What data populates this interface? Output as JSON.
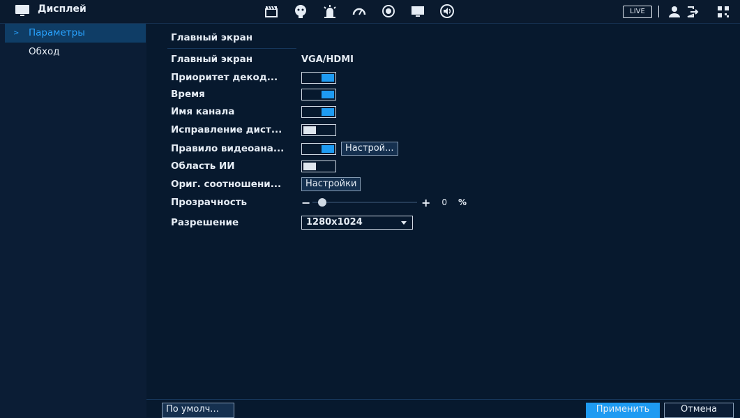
{
  "window": {
    "title": "Дисплей"
  },
  "topbar": {
    "icons": [
      "clapperboard-icon",
      "face-icon",
      "alarm-icon",
      "gauge-icon",
      "record-icon",
      "display-icon",
      "volume-icon"
    ],
    "live_label": "LIVE",
    "right_icons": [
      "user-icon",
      "logout-icon",
      "qr-icon"
    ]
  },
  "sidebar": {
    "items": [
      {
        "label": "Параметры",
        "active": true
      },
      {
        "label": "Обход",
        "active": false
      }
    ]
  },
  "main": {
    "section_title": "Главный экран",
    "rows": [
      {
        "label": "Главный экран",
        "type": "text",
        "value": "VGA/HDMI"
      },
      {
        "label": "Приоритет декод...",
        "type": "toggle",
        "on": true
      },
      {
        "label": "Время",
        "type": "toggle",
        "on": true
      },
      {
        "label": "Имя канала",
        "type": "toggle",
        "on": true
      },
      {
        "label": "Исправление дист...",
        "type": "toggle",
        "on": false
      },
      {
        "label": "Правило видеоана...",
        "type": "toggle",
        "on": true,
        "button": "Настрой..."
      },
      {
        "label": "Область ИИ",
        "type": "toggle",
        "on": false
      },
      {
        "label": "Ориг. соотношени...",
        "type": "button",
        "button": "Настройки"
      },
      {
        "label": "Прозрачность",
        "type": "slider",
        "value": "0",
        "unit": "%",
        "minus": "−",
        "plus": "+"
      },
      {
        "label": "Разрешение",
        "type": "select",
        "value": "1280x1024"
      }
    ]
  },
  "footer": {
    "default_label": "По умолч...",
    "apply_label": "Применить",
    "cancel_label": "Отмена"
  },
  "colors": {
    "accent": "#1e9bf2",
    "background": "#07192e",
    "sidebar_active": "#0f3d66"
  }
}
